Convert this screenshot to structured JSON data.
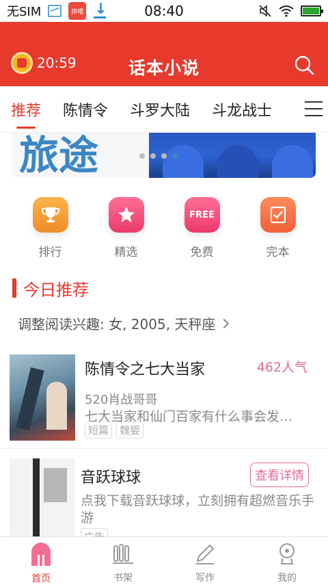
{
  "status_bar": {
    "carrier": "无SIM",
    "app_badge": "拼喂",
    "time": "08:40"
  },
  "header": {
    "timer": "20:59",
    "title": "话本小说"
  },
  "tabs": [
    {
      "label": "推荐"
    },
    {
      "label": "陈情令"
    },
    {
      "label": "斗罗大陆"
    },
    {
      "label": "斗龙战士"
    }
  ],
  "banner": {
    "text": "旅途"
  },
  "categories": [
    {
      "label": "排行",
      "icon": "trophy-icon",
      "color": "#f7a23b"
    },
    {
      "label": "精选",
      "icon": "star-icon",
      "color": "#f24c7a"
    },
    {
      "label": "免费",
      "icon": "free-tag-icon",
      "badge": "FREE",
      "color": "#f2517a"
    },
    {
      "label": "完本",
      "icon": "check-doc-icon",
      "color": "#f47a4b"
    }
  ],
  "section": {
    "title": "今日推荐",
    "prefs": "调整阅读兴趣: 女, 2005, 天秤座"
  },
  "books": [
    {
      "title": "陈情令之七大当家",
      "popularity": "462人气",
      "author": "520肖战哥哥",
      "desc": "七大当家和仙门百家有什么事会发…",
      "tags": [
        "短篇",
        "魏婴"
      ]
    },
    {
      "title": "音跃球球",
      "button": "查看详情",
      "desc": "点我下载音跃球球，立刻拥有超燃音乐手游",
      "tags": [
        "广告"
      ]
    }
  ],
  "bottom_nav": [
    {
      "label": "首页",
      "active": true
    },
    {
      "label": "书架"
    },
    {
      "label": "写作"
    },
    {
      "label": "我的"
    }
  ],
  "colors": {
    "brand": "#e8392d",
    "pink": "#e06a9a",
    "battery": "#2aa52e"
  }
}
